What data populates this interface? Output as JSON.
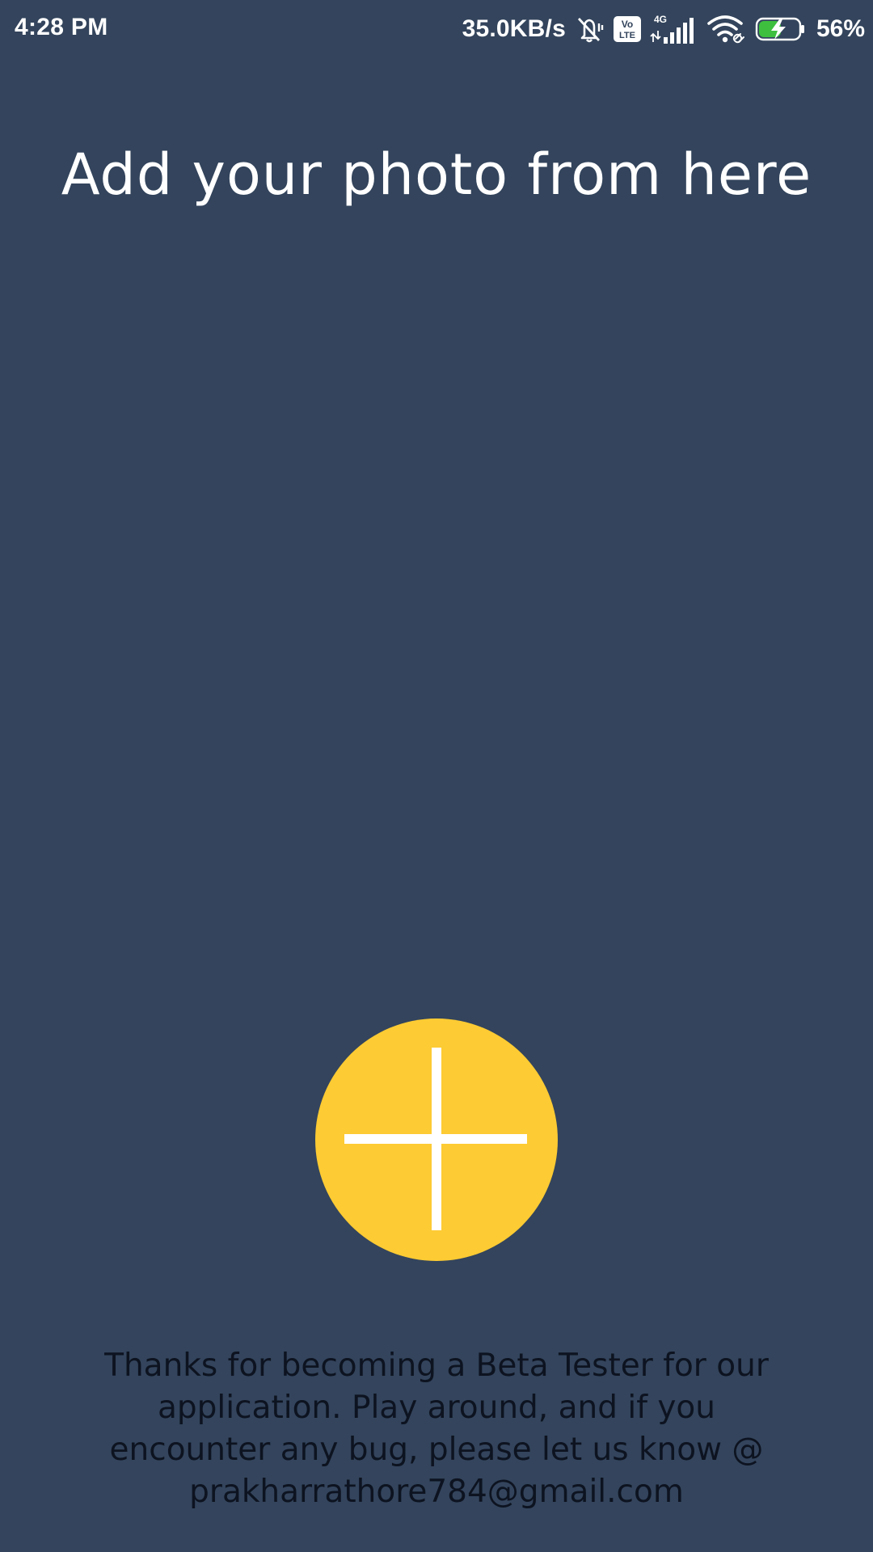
{
  "status_bar": {
    "time": "4:28 PM",
    "net_speed": "35.0KB/s",
    "battery_percent": "56%",
    "network_type": "4G",
    "volte_label_top": "Vo",
    "volte_label_bottom": "LTE",
    "icons": [
      "vibrate-icon",
      "volte-icon",
      "signal-icon",
      "wifi-icon",
      "battery-charging-icon"
    ],
    "battery_level": 0.56
  },
  "main": {
    "title": "Add your photo from here",
    "add_button_icon": "plus-icon",
    "beta_message": "Thanks for becoming a Beta Tester for our application. Play around, and if you encounter any bug, please let us know @ prakharrathore784@gmail.com"
  },
  "colors": {
    "background": "#33445c",
    "accent": "#fdcb33",
    "battery_green": "#3ec03e",
    "message_text": "#0d1320"
  }
}
